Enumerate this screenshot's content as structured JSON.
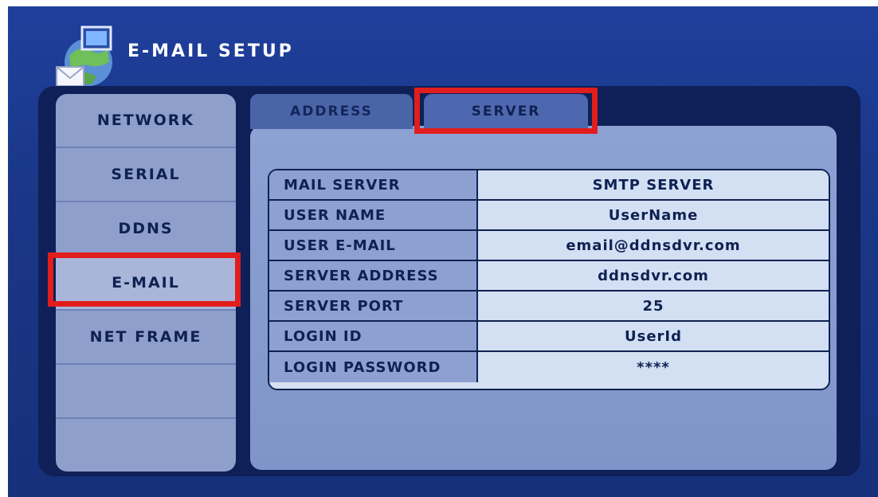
{
  "window": {
    "title": "E-MAIL SETUP"
  },
  "sidebar": {
    "items": [
      {
        "label": "NETWORK"
      },
      {
        "label": "SERIAL"
      },
      {
        "label": "DDNS"
      },
      {
        "label": "E-MAIL",
        "active": true
      },
      {
        "label": "NET FRAME"
      },
      {
        "label": ""
      },
      {
        "label": ""
      }
    ]
  },
  "tabs": [
    {
      "label": "ADDRESS"
    },
    {
      "label": "SERVER",
      "active": true
    }
  ],
  "server_settings": [
    {
      "label": "MAIL SERVER",
      "value": "SMTP SERVER"
    },
    {
      "label": "USER NAME",
      "value": "UserName"
    },
    {
      "label": "USER E-MAIL",
      "value": "email@ddnsdvr.com"
    },
    {
      "label": "SERVER ADDRESS",
      "value": "ddnsdvr.com"
    },
    {
      "label": "SERVER PORT",
      "value": "25"
    },
    {
      "label": "LOGIN ID",
      "value": "UserId"
    },
    {
      "label": "LOGIN PASSWORD",
      "value": "****"
    }
  ],
  "colors": {
    "highlight": "#e11d1d",
    "background": "#1a3788",
    "panel": "#8ea0d2"
  },
  "icons": {
    "app": "globe-email-icon"
  }
}
